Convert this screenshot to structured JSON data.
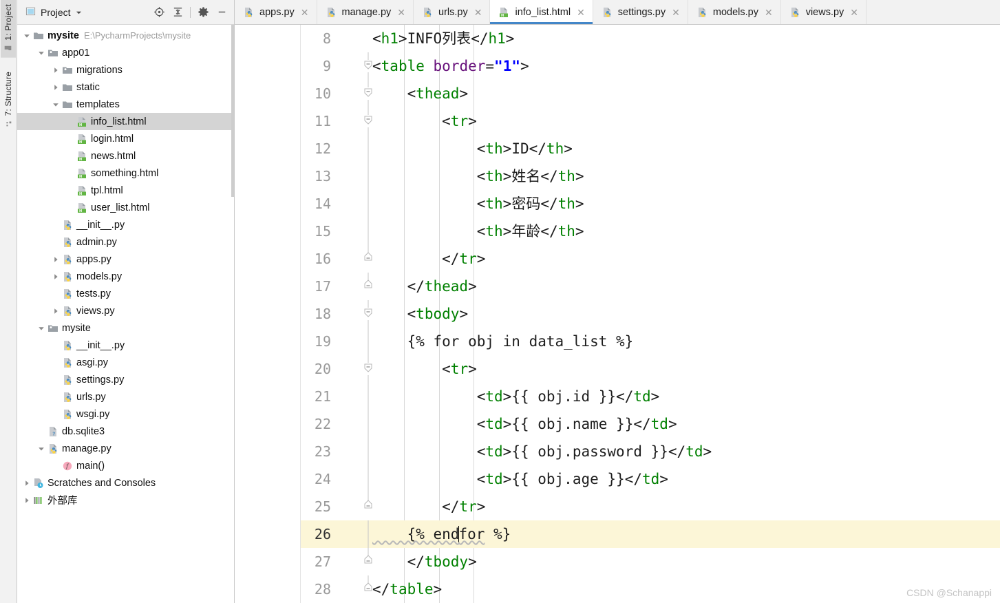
{
  "toolstrip": {
    "tabs": [
      {
        "label": "1: Project",
        "icon": "project-folder-icon",
        "active": true
      },
      {
        "label": "7: Structure",
        "icon": "structure-icon",
        "active": false
      }
    ]
  },
  "project_panel": {
    "title": "Project",
    "dropdown_icon": "chevron-down-icon",
    "icons": [
      {
        "name": "locate-target-icon",
        "title": "Select Opened File"
      },
      {
        "name": "collapse-all-icon",
        "title": "Collapse All"
      },
      {
        "name": "gear-icon",
        "title": "Settings"
      },
      {
        "name": "minimize-icon",
        "title": "Hide"
      }
    ],
    "tree": [
      {
        "label": "mysite",
        "sub": "E:\\PycharmProjects\\mysite",
        "indent": 0,
        "arrow": "down",
        "icon": "folder-root-icon",
        "bold": true,
        "selected": false
      },
      {
        "label": "app01",
        "sub": "",
        "indent": 1,
        "arrow": "down",
        "icon": "folder-module-icon",
        "bold": false,
        "selected": false
      },
      {
        "label": "migrations",
        "sub": "",
        "indent": 2,
        "arrow": "right",
        "icon": "folder-module-icon",
        "bold": false,
        "selected": false
      },
      {
        "label": "static",
        "sub": "",
        "indent": 2,
        "arrow": "right",
        "icon": "folder-icon",
        "bold": false,
        "selected": false
      },
      {
        "label": "templates",
        "sub": "",
        "indent": 2,
        "arrow": "down",
        "icon": "folder-icon",
        "bold": false,
        "selected": false
      },
      {
        "label": "info_list.html",
        "sub": "",
        "indent": 3,
        "arrow": "none",
        "icon": "html-file-icon",
        "bold": false,
        "selected": true
      },
      {
        "label": "login.html",
        "sub": "",
        "indent": 3,
        "arrow": "none",
        "icon": "html-file-icon",
        "bold": false,
        "selected": false
      },
      {
        "label": "news.html",
        "sub": "",
        "indent": 3,
        "arrow": "none",
        "icon": "html-file-icon",
        "bold": false,
        "selected": false
      },
      {
        "label": "something.html",
        "sub": "",
        "indent": 3,
        "arrow": "none",
        "icon": "html-file-icon",
        "bold": false,
        "selected": false
      },
      {
        "label": "tpl.html",
        "sub": "",
        "indent": 3,
        "arrow": "none",
        "icon": "html-file-icon",
        "bold": false,
        "selected": false
      },
      {
        "label": "user_list.html",
        "sub": "",
        "indent": 3,
        "arrow": "none",
        "icon": "html-file-icon",
        "bold": false,
        "selected": false
      },
      {
        "label": "__init__.py",
        "sub": "",
        "indent": 2,
        "arrow": "none",
        "icon": "python-file-icon",
        "bold": false,
        "selected": false
      },
      {
        "label": "admin.py",
        "sub": "",
        "indent": 2,
        "arrow": "none",
        "icon": "python-file-icon",
        "bold": false,
        "selected": false
      },
      {
        "label": "apps.py",
        "sub": "",
        "indent": 2,
        "arrow": "right",
        "icon": "python-file-icon",
        "bold": false,
        "selected": false
      },
      {
        "label": "models.py",
        "sub": "",
        "indent": 2,
        "arrow": "right",
        "icon": "python-file-icon",
        "bold": false,
        "selected": false
      },
      {
        "label": "tests.py",
        "sub": "",
        "indent": 2,
        "arrow": "none",
        "icon": "python-file-icon",
        "bold": false,
        "selected": false
      },
      {
        "label": "views.py",
        "sub": "",
        "indent": 2,
        "arrow": "right",
        "icon": "python-file-icon",
        "bold": false,
        "selected": false
      },
      {
        "label": "mysite",
        "sub": "",
        "indent": 1,
        "arrow": "down",
        "icon": "folder-module-icon",
        "bold": false,
        "selected": false
      },
      {
        "label": "__init__.py",
        "sub": "",
        "indent": 2,
        "arrow": "none",
        "icon": "python-file-icon",
        "bold": false,
        "selected": false
      },
      {
        "label": "asgi.py",
        "sub": "",
        "indent": 2,
        "arrow": "none",
        "icon": "python-file-icon",
        "bold": false,
        "selected": false
      },
      {
        "label": "settings.py",
        "sub": "",
        "indent": 2,
        "arrow": "none",
        "icon": "python-file-icon",
        "bold": false,
        "selected": false
      },
      {
        "label": "urls.py",
        "sub": "",
        "indent": 2,
        "arrow": "none",
        "icon": "python-file-icon",
        "bold": false,
        "selected": false
      },
      {
        "label": "wsgi.py",
        "sub": "",
        "indent": 2,
        "arrow": "none",
        "icon": "python-file-icon",
        "bold": false,
        "selected": false
      },
      {
        "label": "db.sqlite3",
        "sub": "",
        "indent": 1,
        "arrow": "none",
        "icon": "unknown-file-icon",
        "bold": false,
        "selected": false
      },
      {
        "label": "manage.py",
        "sub": "",
        "indent": 1,
        "arrow": "down",
        "icon": "python-file-icon",
        "bold": false,
        "selected": false
      },
      {
        "label": "main()",
        "sub": "",
        "indent": 2,
        "arrow": "none",
        "icon": "function-icon",
        "bold": false,
        "selected": false
      },
      {
        "label": "Scratches and Consoles",
        "sub": "",
        "indent": 0,
        "arrow": "right",
        "icon": "scratches-icon",
        "bold": false,
        "selected": false
      },
      {
        "label": "外部库",
        "sub": "",
        "indent": 0,
        "arrow": "right",
        "icon": "external-libraries-icon",
        "bold": false,
        "selected": false
      }
    ]
  },
  "tabbar": {
    "tabs": [
      {
        "label": "apps.py",
        "icon": "python-file-icon",
        "active": false,
        "close_icon": "close-icon"
      },
      {
        "label": "manage.py",
        "icon": "python-file-icon",
        "active": false,
        "close_icon": "close-icon"
      },
      {
        "label": "urls.py",
        "icon": "python-file-icon",
        "active": false,
        "close_icon": "close-icon"
      },
      {
        "label": "info_list.html",
        "icon": "html-file-icon",
        "active": true,
        "close_icon": "close-icon"
      },
      {
        "label": "settings.py",
        "icon": "python-file-icon",
        "active": false,
        "close_icon": "close-icon"
      },
      {
        "label": "models.py",
        "icon": "python-file-icon",
        "active": false,
        "close_icon": "close-icon"
      },
      {
        "label": "views.py",
        "icon": "python-file-icon",
        "active": false,
        "close_icon": "close-icon"
      }
    ],
    "active_underline_color": "#4386c8"
  },
  "editor": {
    "current_line": 26,
    "current_line_highlight": "#fcf6d7",
    "lines": [
      {
        "n": 8,
        "indent": 0,
        "fold": "none",
        "tokens": [
          {
            "t": "<",
            "c": "br"
          },
          {
            "t": "h1",
            "c": "tg"
          },
          {
            "t": ">",
            "c": "br"
          },
          {
            "t": "INFO列表",
            "c": "br"
          },
          {
            "t": "</",
            "c": "br"
          },
          {
            "t": "h1",
            "c": "tg"
          },
          {
            "t": ">",
            "c": "br"
          }
        ]
      },
      {
        "n": 9,
        "indent": 0,
        "fold": "open",
        "tokens": [
          {
            "t": "<",
            "c": "br"
          },
          {
            "t": "table",
            "c": "tg"
          },
          {
            "t": " ",
            "c": "br"
          },
          {
            "t": "border",
            "c": "at"
          },
          {
            "t": "=",
            "c": "br"
          },
          {
            "t": "\"1\"",
            "c": "st"
          },
          {
            "t": ">",
            "c": "br"
          }
        ]
      },
      {
        "n": 10,
        "indent": 1,
        "fold": "open",
        "tokens": [
          {
            "t": "    <",
            "c": "br"
          },
          {
            "t": "thead",
            "c": "tg"
          },
          {
            "t": ">",
            "c": "br"
          }
        ]
      },
      {
        "n": 11,
        "indent": 2,
        "fold": "open",
        "tokens": [
          {
            "t": "        <",
            "c": "br"
          },
          {
            "t": "tr",
            "c": "tg"
          },
          {
            "t": ">",
            "c": "br"
          }
        ]
      },
      {
        "n": 12,
        "indent": 3,
        "fold": "none",
        "tokens": [
          {
            "t": "            <",
            "c": "br"
          },
          {
            "t": "th",
            "c": "tg"
          },
          {
            "t": ">",
            "c": "br"
          },
          {
            "t": "ID",
            "c": "br"
          },
          {
            "t": "</",
            "c": "br"
          },
          {
            "t": "th",
            "c": "tg"
          },
          {
            "t": ">",
            "c": "br"
          }
        ]
      },
      {
        "n": 13,
        "indent": 3,
        "fold": "none",
        "tokens": [
          {
            "t": "            <",
            "c": "br"
          },
          {
            "t": "th",
            "c": "tg"
          },
          {
            "t": ">",
            "c": "br"
          },
          {
            "t": "姓名",
            "c": "br"
          },
          {
            "t": "</",
            "c": "br"
          },
          {
            "t": "th",
            "c": "tg"
          },
          {
            "t": ">",
            "c": "br"
          }
        ]
      },
      {
        "n": 14,
        "indent": 3,
        "fold": "none",
        "tokens": [
          {
            "t": "            <",
            "c": "br"
          },
          {
            "t": "th",
            "c": "tg"
          },
          {
            "t": ">",
            "c": "br"
          },
          {
            "t": "密码",
            "c": "br"
          },
          {
            "t": "</",
            "c": "br"
          },
          {
            "t": "th",
            "c": "tg"
          },
          {
            "t": ">",
            "c": "br"
          }
        ]
      },
      {
        "n": 15,
        "indent": 3,
        "fold": "none",
        "tokens": [
          {
            "t": "            <",
            "c": "br"
          },
          {
            "t": "th",
            "c": "tg"
          },
          {
            "t": ">",
            "c": "br"
          },
          {
            "t": "年龄",
            "c": "br"
          },
          {
            "t": "</",
            "c": "br"
          },
          {
            "t": "th",
            "c": "tg"
          },
          {
            "t": ">",
            "c": "br"
          }
        ]
      },
      {
        "n": 16,
        "indent": 2,
        "fold": "close",
        "tokens": [
          {
            "t": "        </",
            "c": "br"
          },
          {
            "t": "tr",
            "c": "tg"
          },
          {
            "t": ">",
            "c": "br"
          }
        ]
      },
      {
        "n": 17,
        "indent": 1,
        "fold": "close",
        "tokens": [
          {
            "t": "    </",
            "c": "br"
          },
          {
            "t": "thead",
            "c": "tg"
          },
          {
            "t": ">",
            "c": "br"
          }
        ]
      },
      {
        "n": 18,
        "indent": 1,
        "fold": "open",
        "tokens": [
          {
            "t": "    <",
            "c": "br"
          },
          {
            "t": "tbody",
            "c": "tg"
          },
          {
            "t": ">",
            "c": "br"
          }
        ]
      },
      {
        "n": 19,
        "indent": 1,
        "fold": "none",
        "tokens": [
          {
            "t": "    {% for obj in data_list %}",
            "c": "dj"
          }
        ]
      },
      {
        "n": 20,
        "indent": 2,
        "fold": "open",
        "tokens": [
          {
            "t": "        <",
            "c": "br"
          },
          {
            "t": "tr",
            "c": "tg"
          },
          {
            "t": ">",
            "c": "br"
          }
        ]
      },
      {
        "n": 21,
        "indent": 3,
        "fold": "none",
        "tokens": [
          {
            "t": "            <",
            "c": "br"
          },
          {
            "t": "td",
            "c": "tg"
          },
          {
            "t": ">",
            "c": "br"
          },
          {
            "t": "{{ obj.id }}",
            "c": "dj"
          },
          {
            "t": "</",
            "c": "br"
          },
          {
            "t": "td",
            "c": "tg"
          },
          {
            "t": ">",
            "c": "br"
          }
        ]
      },
      {
        "n": 22,
        "indent": 3,
        "fold": "none",
        "tokens": [
          {
            "t": "            <",
            "c": "br"
          },
          {
            "t": "td",
            "c": "tg"
          },
          {
            "t": ">",
            "c": "br"
          },
          {
            "t": "{{ obj.name }}",
            "c": "dj"
          },
          {
            "t": "</",
            "c": "br"
          },
          {
            "t": "td",
            "c": "tg"
          },
          {
            "t": ">",
            "c": "br"
          }
        ]
      },
      {
        "n": 23,
        "indent": 3,
        "fold": "none",
        "tokens": [
          {
            "t": "            <",
            "c": "br"
          },
          {
            "t": "td",
            "c": "tg"
          },
          {
            "t": ">",
            "c": "br"
          },
          {
            "t": "{{ obj.password }}",
            "c": "dj"
          },
          {
            "t": "</",
            "c": "br"
          },
          {
            "t": "td",
            "c": "tg"
          },
          {
            "t": ">",
            "c": "br"
          }
        ]
      },
      {
        "n": 24,
        "indent": 3,
        "fold": "none",
        "tokens": [
          {
            "t": "            <",
            "c": "br"
          },
          {
            "t": "td",
            "c": "tg"
          },
          {
            "t": ">",
            "c": "br"
          },
          {
            "t": "{{ obj.age }}",
            "c": "dj"
          },
          {
            "t": "</",
            "c": "br"
          },
          {
            "t": "td",
            "c": "tg"
          },
          {
            "t": ">",
            "c": "br"
          }
        ]
      },
      {
        "n": 25,
        "indent": 2,
        "fold": "close",
        "tokens": [
          {
            "t": "        </",
            "c": "br"
          },
          {
            "t": "tr",
            "c": "tg"
          },
          {
            "t": ">",
            "c": "br"
          }
        ]
      },
      {
        "n": 26,
        "indent": 1,
        "fold": "none",
        "current": true,
        "tokens": [
          {
            "t": "    {% end",
            "c": "dj",
            "squig": true
          },
          {
            "t": "CARET",
            "c": "caret"
          },
          {
            "t": "for",
            "c": "dj",
            "squig": true
          },
          {
            "t": " %}",
            "c": "dj"
          }
        ]
      },
      {
        "n": 27,
        "indent": 1,
        "fold": "close",
        "tokens": [
          {
            "t": "    </",
            "c": "br"
          },
          {
            "t": "tbody",
            "c": "tg"
          },
          {
            "t": ">",
            "c": "br"
          }
        ]
      },
      {
        "n": 28,
        "indent": 0,
        "fold": "close",
        "tokens": [
          {
            "t": "</",
            "c": "br"
          },
          {
            "t": "table",
            "c": "tg"
          },
          {
            "t": ">",
            "c": "br"
          }
        ]
      }
    ]
  },
  "watermark": "CSDN @Schanappi"
}
